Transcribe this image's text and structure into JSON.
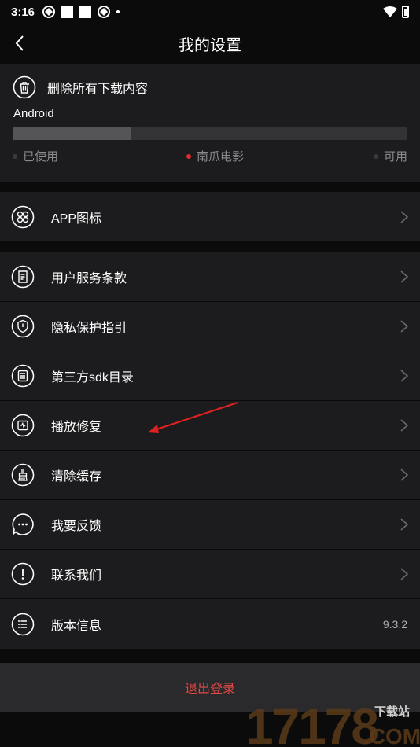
{
  "status_bar": {
    "time": "3:16"
  },
  "header": {
    "title": "我的设置"
  },
  "storage": {
    "clear_all_label": "删除所有下载内容",
    "device_name": "Android",
    "used_fraction": 0.3,
    "legend": [
      {
        "label": "已使用",
        "color": "#555557"
      },
      {
        "label": "南瓜电影",
        "color": "#e02b2b"
      },
      {
        "label": "可用",
        "color": "#444446"
      }
    ]
  },
  "app_icon_item": {
    "label": "APP图标"
  },
  "menu": [
    {
      "label": "用户服务条款",
      "icon": "document-icon"
    },
    {
      "label": "隐私保护指引",
      "icon": "shield-icon"
    },
    {
      "label": "第三方sdk目录",
      "icon": "list-icon"
    },
    {
      "label": "播放修复",
      "icon": "repair-icon"
    },
    {
      "label": "清除缓存",
      "icon": "broom-icon"
    },
    {
      "label": "我要反馈",
      "icon": "chat-icon"
    },
    {
      "label": "联系我们",
      "icon": "alert-circle-icon"
    }
  ],
  "version": {
    "label": "版本信息",
    "value": "9.3.2"
  },
  "logout": {
    "label": "退出登录"
  },
  "watermark": {
    "number": "17178",
    "tag": "下载站",
    "suffix": ".COM"
  },
  "colors": {
    "accent_red": "#e24845",
    "card_bg": "#1c1c1e",
    "page_bg": "#0b0b0b"
  }
}
